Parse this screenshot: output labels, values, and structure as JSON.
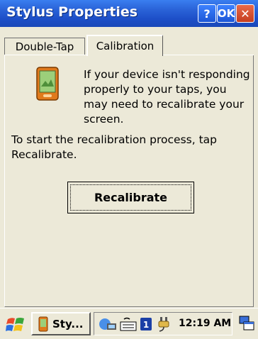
{
  "window": {
    "title": "Stylus Properties",
    "help_label": "?",
    "ok_label": "OK",
    "close_label": "✕"
  },
  "tabs": [
    {
      "label": "Double-Tap",
      "selected": false
    },
    {
      "label": "Calibration",
      "selected": true
    }
  ],
  "calibration": {
    "info_text": "If your device isn't responding properly to your taps, you may need to recalibrate your screen.",
    "instruction_text": "To start the recalibration process, tap Recalibrate.",
    "button_label": "Recalibrate"
  },
  "taskbar": {
    "task_label": "Sty...",
    "clock": "12:19 AM",
    "tray_icons": [
      "network-icon",
      "keyboard-icon",
      "input-panel-icon",
      "power-icon"
    ]
  },
  "colors": {
    "titlebar": "#1d4fc8",
    "background": "#ece9d8",
    "close_button": "#c53d1f"
  }
}
